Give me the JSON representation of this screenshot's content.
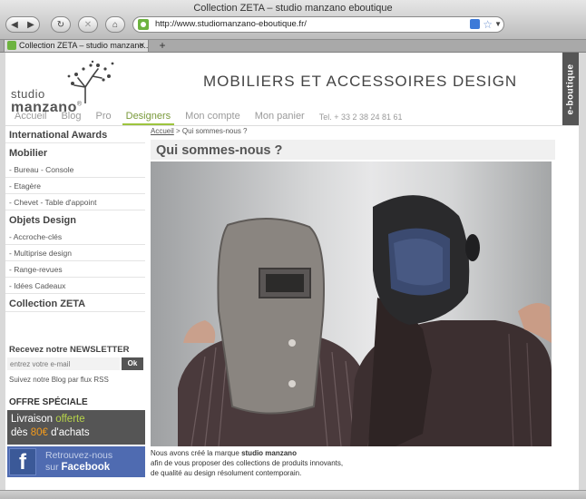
{
  "browser": {
    "window_title": "Collection ZETA – studio manzano eboutique",
    "url": "http://www.studiomanzano-eboutique.fr/",
    "tab_title": "Collection ZETA – studio manzano...",
    "new_tab_label": "+",
    "close_tab_label": "✕"
  },
  "header": {
    "logo_top": "studio",
    "logo_bottom": "manzano",
    "logo_mark": "®",
    "site_title": "MOBILIERS ET ACCESSOIRES DESIGN",
    "eboutique_label": "e-boutique"
  },
  "nav": {
    "items": [
      "Accueil",
      "Blog",
      "Pro",
      "Designers",
      "Mon compte",
      "Mon panier"
    ],
    "active_index": 3,
    "phone": "Tel. + 33 2 38 24 81 61"
  },
  "sidebar": {
    "international_awards": "International Awards",
    "mobilier_heading": "Mobilier",
    "mobilier_items": [
      "- Bureau - Console",
      "- Etagère",
      "- Chevet - Table d'appoint"
    ],
    "objets_heading": "Objets Design",
    "objets_items": [
      "- Accroche-clés",
      "- Multiprise design",
      "- Range-revues",
      "- Idées Cadeaux"
    ],
    "collection_heading": "Collection ZETA",
    "newsletter_title": "Recevez notre NEWSLETTER",
    "newsletter_placeholder": "entrez votre e-mail",
    "newsletter_ok": "Ok",
    "rss_text": "Suivez notre Blog par flux RSS",
    "offer_title": "OFFRE SPÉCIALE",
    "offer_line1_a": "Livraison ",
    "offer_line1_b": "offerte",
    "offer_line2_a": "dès ",
    "offer_line2_b": "80€",
    "offer_line2_c": " d'achats",
    "facebook_line1": "Retrouvez-nous",
    "facebook_line2_a": "sur ",
    "facebook_line2_b": "Facebook",
    "facebook_icon_letter": "f"
  },
  "main": {
    "breadcrumb_home": "Accueil",
    "breadcrumb_sep": " > ",
    "breadcrumb_current": "Qui sommes-nous ?",
    "page_title": "Qui sommes-nous ?",
    "text_a": "Nous avons créé la marque ",
    "text_brand": "studio manzano",
    "text_b": "afin de vous proposer des collections de produits innovants,",
    "text_c": "de qualité au design résolument contemporain."
  },
  "colors": {
    "accent_green": "#9dc43d",
    "offer_bg": "#555555",
    "facebook_blue": "#4f6bb1"
  }
}
